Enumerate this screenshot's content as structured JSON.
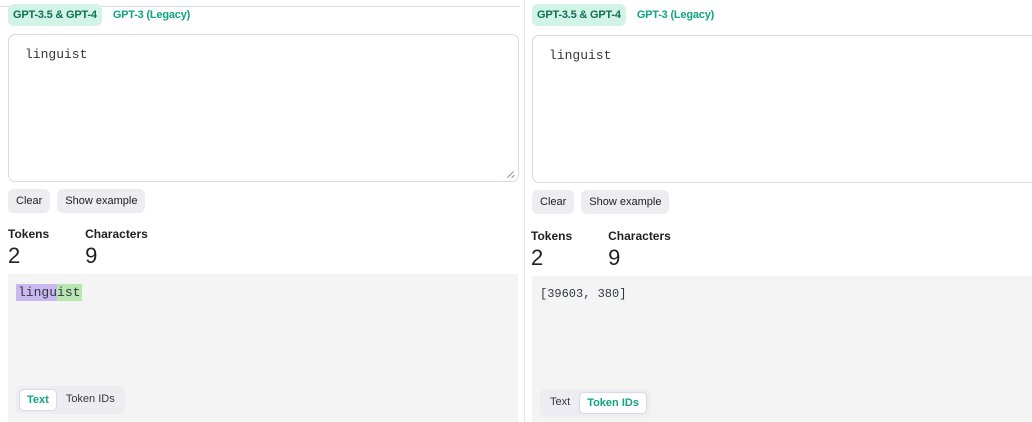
{
  "panels": [
    {
      "model_tabs": [
        {
          "label": "GPT-3.5 & GPT-4",
          "active": true
        },
        {
          "label": "GPT-3 (Legacy)",
          "active": false
        }
      ],
      "input": {
        "value": "linguist"
      },
      "buttons": {
        "clear": "Clear",
        "show_example": "Show example"
      },
      "stats": {
        "tokens_label": "Tokens",
        "tokens_value": "2",
        "characters_label": "Characters",
        "characters_value": "9"
      },
      "output": {
        "tokens": [
          "lingu",
          "ist"
        ]
      },
      "view_toggle": {
        "text": "Text",
        "token_ids": "Token IDs",
        "active": "text"
      }
    },
    {
      "model_tabs": [
        {
          "label": "GPT-3.5 & GPT-4",
          "active": true
        },
        {
          "label": "GPT-3 (Legacy)",
          "active": false
        }
      ],
      "input": {
        "value": "linguist"
      },
      "buttons": {
        "clear": "Clear",
        "show_example": "Show example"
      },
      "stats": {
        "tokens_label": "Tokens",
        "tokens_value": "2",
        "characters_label": "Characters",
        "characters_value": "9"
      },
      "output": {
        "token_ids": "[39603, 380]"
      },
      "view_toggle": {
        "text": "Text",
        "token_ids": "Token IDs",
        "active": "token_ids"
      }
    }
  ],
  "colors": {
    "accent": "#10a37f",
    "active_tab_bg": "#d2f4e7",
    "token_1": "#c9b9f0",
    "token_2": "#b8e6b0",
    "output_bg": "#f4f4f4"
  },
  "icons": {
    "resize": "resize-grip-icon"
  }
}
